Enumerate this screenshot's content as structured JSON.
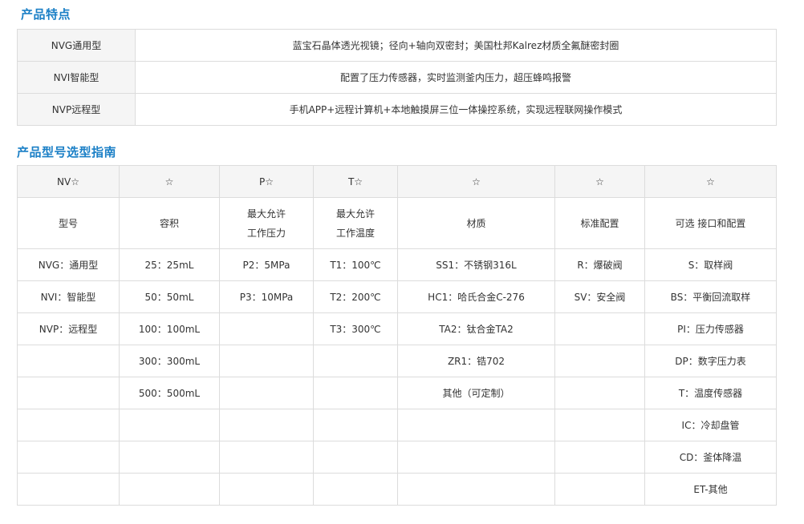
{
  "features": {
    "title": "产品特点",
    "rows": [
      {
        "name": "NVG通用型",
        "desc": "蓝宝石晶体透光视镜；径向+轴向双密封；美国杜邦Kalrez材质全氟醚密封圈"
      },
      {
        "name": "NVI智能型",
        "desc": "配置了压力传感器，实时监测釜内压力，超压蜂鸣报警"
      },
      {
        "name": "NVP远程型",
        "desc": "手机APP+远程计算机+本地触摸屏三位一体操控系统，实现远程联网操作模式"
      }
    ]
  },
  "guide": {
    "title": "产品型号选型指南",
    "codes": [
      "NV☆",
      "☆",
      "P☆",
      "T☆",
      "☆",
      "☆",
      "☆"
    ],
    "labels": [
      [
        "型号"
      ],
      [
        "容积"
      ],
      [
        "最大允许",
        "工作压力"
      ],
      [
        "最大允许",
        "工作温度"
      ],
      [
        "材质"
      ],
      [
        "标准配置"
      ],
      [
        "可选 接口和配置"
      ]
    ],
    "rows": [
      [
        "NVG：通用型",
        "25：25mL",
        "P2：5MPa",
        "T1：100℃",
        "SS1：不锈钢316L",
        "R：爆破阀",
        "S：取样阀"
      ],
      [
        "NVI：智能型",
        "50：50mL",
        "P3：10MPa",
        "T2：200℃",
        "HC1：哈氏合金C-276",
        "SV：安全阀",
        "BS：平衡回流取样"
      ],
      [
        "NVP：远程型",
        "100：100mL",
        "",
        "T3：300℃",
        "TA2：钛合金TA2",
        "",
        "PI：压力传感器"
      ],
      [
        "",
        "300：300mL",
        "",
        "",
        "ZR1：锆702",
        "",
        "DP：数字压力表"
      ],
      [
        "",
        "500：500mL",
        "",
        "",
        "其他（可定制）",
        "",
        "T：温度传感器"
      ],
      [
        "",
        "",
        "",
        "",
        "",
        "",
        "IC：冷却盘管"
      ],
      [
        "",
        "",
        "",
        "",
        "",
        "",
        "CD：釜体降温"
      ],
      [
        "",
        "",
        "",
        "",
        "",
        "",
        "ET-其他"
      ]
    ]
  }
}
